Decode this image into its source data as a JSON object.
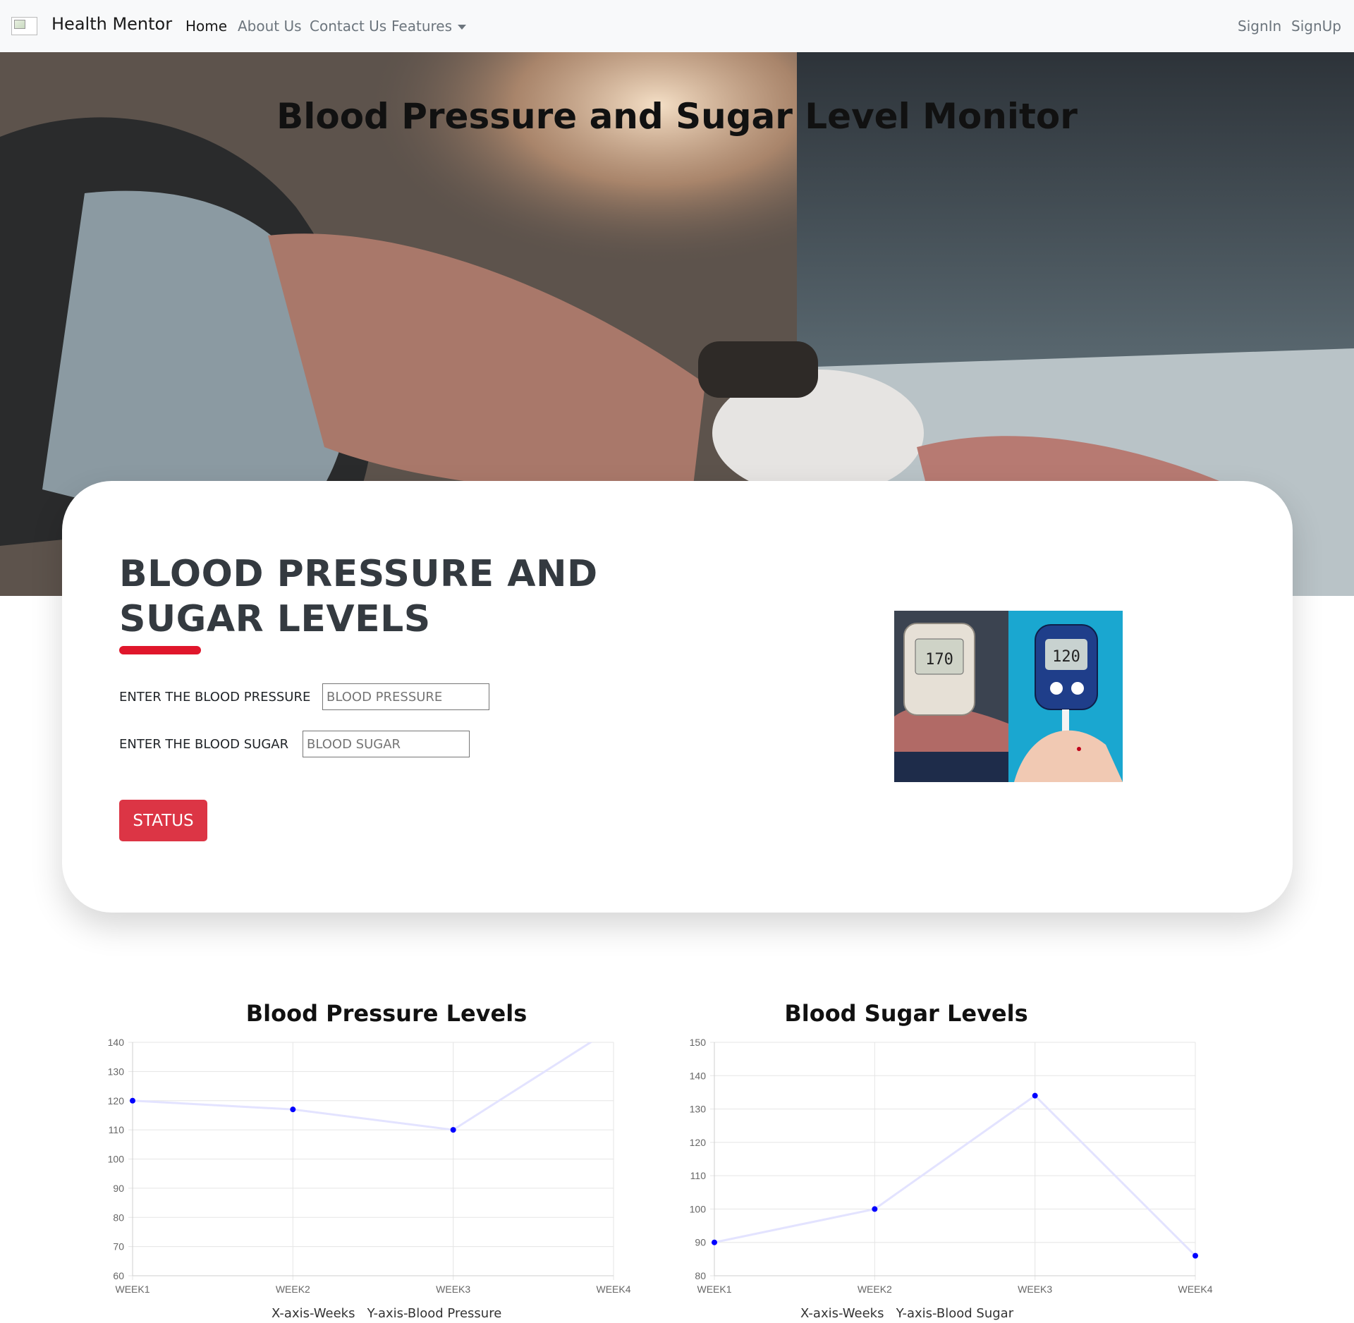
{
  "navbar": {
    "brand": "Health Mentor",
    "links": [
      "Home",
      "About Us",
      "Contact Us",
      "Features"
    ],
    "right_links": [
      "SignIn",
      "SignUp"
    ],
    "background": "#f8f9fa"
  },
  "hero": {
    "title": "Blood Pressure and Sugar Level Monitor"
  },
  "card": {
    "heading": "BLOOD PRESSURE AND SUGAR LEVELS",
    "accent_color": "#e0162b",
    "bp_label": "ENTER THE BLOOD PRESSURE",
    "bp_placeholder": "BLOOD PRESSURE",
    "sugar_label": "ENTER THE BLOOD SUGAR",
    "sugar_placeholder": "BLOOD SUGAR",
    "button_label": "STATUS",
    "button_color": "#dc3545",
    "image_readings": [
      "170",
      "120"
    ]
  },
  "chart_data": [
    {
      "type": "line",
      "title": "Blood Pressure Levels",
      "categories": [
        "WEEK1",
        "WEEK2",
        "WEEK3",
        "WEEK4"
      ],
      "series": [
        {
          "values": [
            120,
            117,
            110,
            145
          ]
        }
      ],
      "ylim": [
        60,
        140
      ],
      "yticks": [
        60,
        70,
        80,
        90,
        100,
        110,
        120,
        130,
        140
      ],
      "caption": "X-axis-Weeks   Y-axis-Blood Pressure",
      "grid": true,
      "point_color": "#0000ff",
      "line_color": "#e3e3ff"
    },
    {
      "type": "line",
      "title": "Blood Sugar Levels",
      "categories": [
        "WEEK1",
        "WEEK2",
        "WEEK3",
        "WEEK4"
      ],
      "series": [
        {
          "values": [
            90,
            100,
            134,
            86
          ]
        }
      ],
      "ylim": [
        80,
        150
      ],
      "yticks": [
        80,
        90,
        100,
        110,
        120,
        130,
        140,
        150
      ],
      "caption": "X-axis-Weeks   Y-axis-Blood Sugar",
      "grid": true,
      "point_color": "#0000ff",
      "line_color": "#e3e3ff"
    }
  ]
}
